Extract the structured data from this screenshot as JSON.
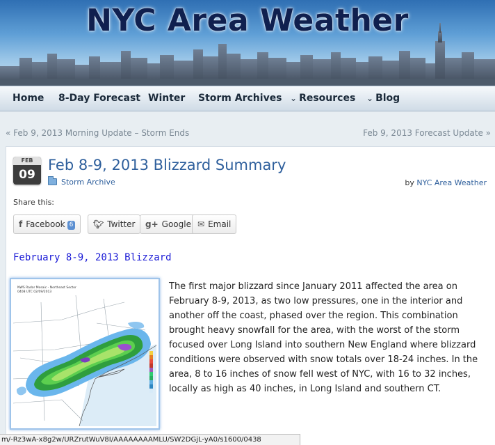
{
  "site": {
    "title": "NYC Area Weather"
  },
  "nav": {
    "items": [
      {
        "label": "Home",
        "dropdown": false
      },
      {
        "label": "8-Day Forecast",
        "dropdown": false
      },
      {
        "label": "Winter",
        "dropdown": false
      },
      {
        "label": "Storm Archives",
        "dropdown": false
      },
      {
        "label": "Resources",
        "dropdown": true
      },
      {
        "label": "Blog",
        "dropdown": true
      }
    ]
  },
  "post_nav": {
    "prev": "« Feb 9, 2013 Morning Update – Storm Ends",
    "next": "Feb 9, 2013 Forecast Update »"
  },
  "post": {
    "date_month": "FEB",
    "date_day": "09",
    "title": "Feb 8-9, 2013 Blizzard Summary",
    "category": "Storm Archive",
    "byline_prefix": "by",
    "author": "NYC Area Weather",
    "share_label": "Share this:",
    "share_buttons": [
      {
        "label": "Facebook",
        "icon": "facebook-icon",
        "count": "6"
      },
      {
        "label": "Twitter",
        "icon": "twitter-icon"
      },
      {
        "label": "Google",
        "icon": "google-plus-icon"
      },
      {
        "label": "Email",
        "icon": "email-icon"
      }
    ],
    "section_heading": "February 8-9, 2013 Blizzard",
    "radar_caption_line1": "NWS Radar Mosaic - Northeast Sector",
    "radar_caption_line2": "0408 UTC 02/09/2013",
    "body": "The first major blizzard since January 2011 affected the area on February 8-9, 2013, as two low pressures, one in the interior and another off the coast, phased over the region. This combination brought heavy snowfall for the area, with the worst of the storm focused over Long Island into southern New England where blizzard conditions were observed with snow totals over 18-24 inches. In the area, 8 to 16 inches of snow fell west of NYC, with 16 to 32 inches, locally as high as 40 inches, in Long Island and southern CT."
  },
  "status_bar": {
    "url": "m/-Rz3wA-x8g2w/URZrutWuV8I/AAAAAAAAMLU/SW2DGjL-yA0/s1600/0438"
  },
  "colors": {
    "link": "#2e5f9c",
    "heading_blue": "#1a1ad6",
    "nav_text": "#1b2a3a"
  }
}
